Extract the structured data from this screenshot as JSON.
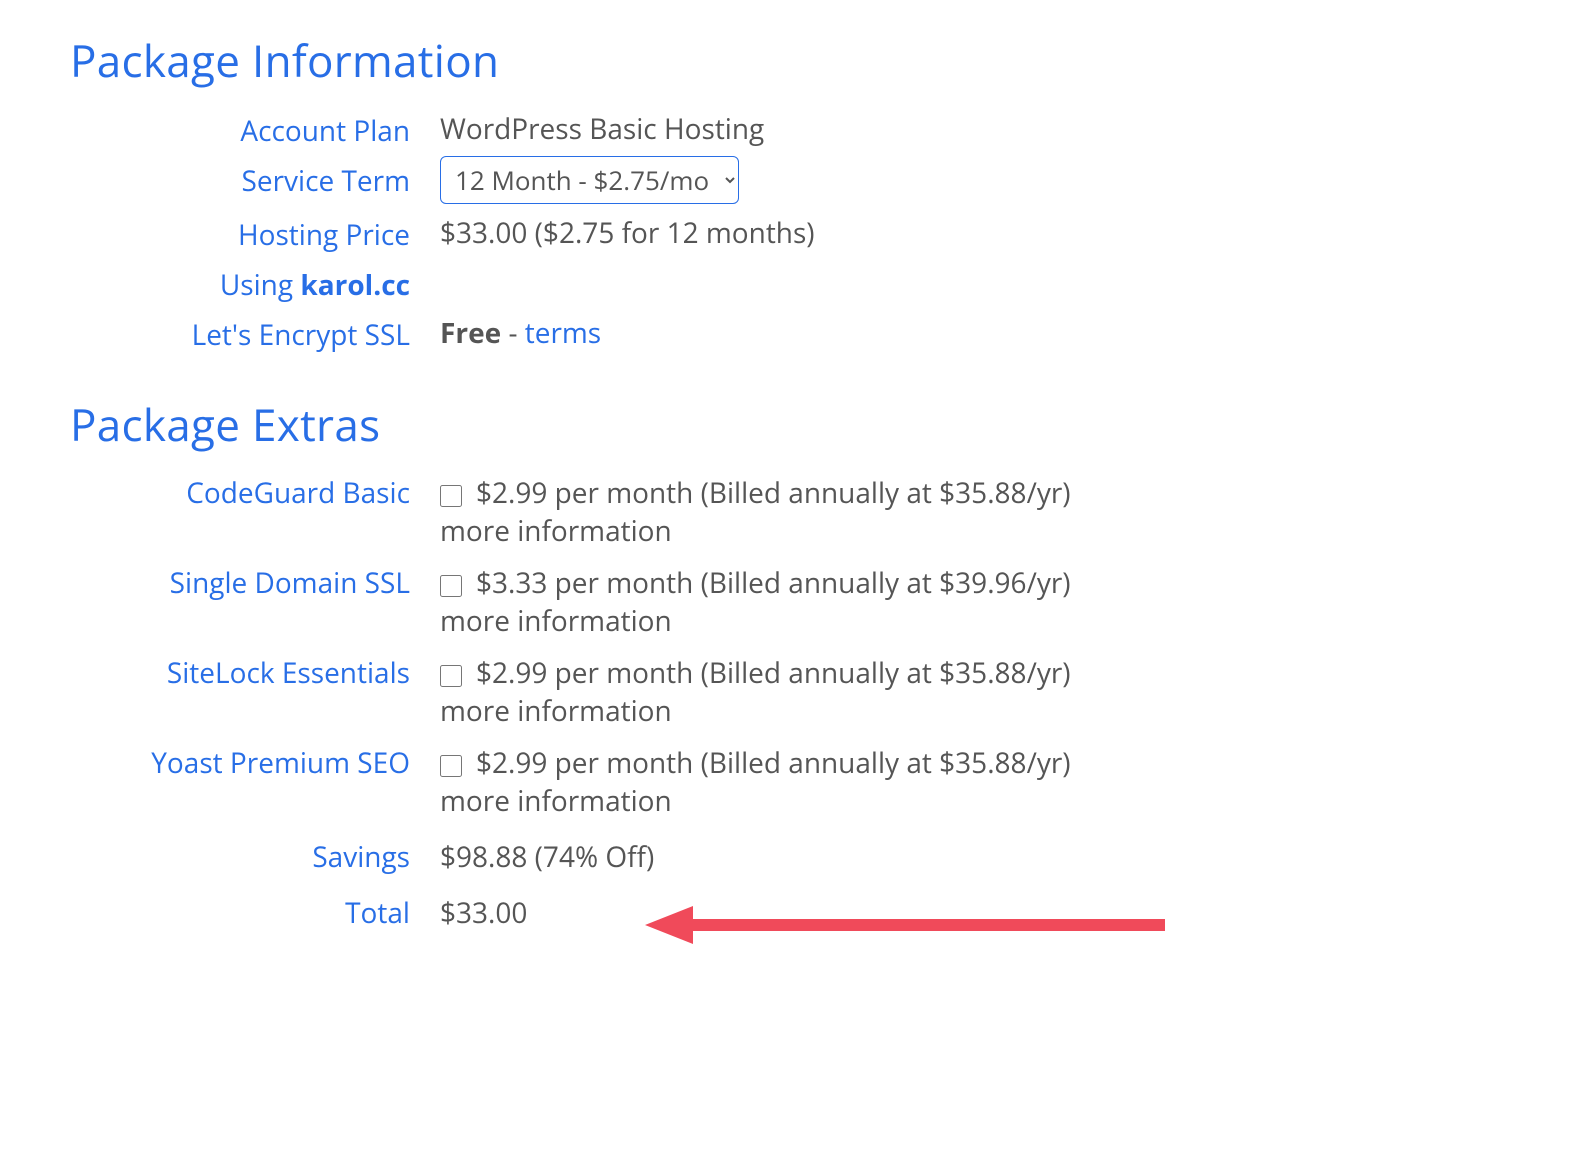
{
  "sections": {
    "info_heading": "Package Information",
    "extras_heading": "Package Extras"
  },
  "labels": {
    "account_plan": "Account Plan",
    "service_term": "Service Term",
    "hosting_price": "Hosting Price",
    "using_prefix": "Using ",
    "domain": "karol.cc",
    "ssl_label": "Let's Encrypt SSL",
    "savings": "Savings",
    "total": "Total"
  },
  "values": {
    "account_plan": "WordPress Basic Hosting",
    "service_term_selected": "12 Month - $2.75/mo",
    "hosting_price": "$33.00 ($2.75 for 12 months)",
    "ssl_free": "Free",
    "ssl_dash": " - ",
    "ssl_terms": "terms",
    "savings": "$98.88 (74% Off)",
    "total": "$33.00"
  },
  "extras": [
    {
      "name": "CodeGuard Basic",
      "price": "$2.99 per month (Billed annually at $35.88/yr)",
      "more": "more information"
    },
    {
      "name": "Single Domain SSL",
      "price": "$3.33 per month (Billed annually at $39.96/yr)",
      "more": "more information"
    },
    {
      "name": "SiteLock Essentials",
      "price": "$2.99 per month (Billed annually at $35.88/yr)",
      "more": "more information"
    },
    {
      "name": "Yoast Premium SEO",
      "price": "$2.99 per month (Billed annually at $35.88/yr)",
      "more": "more information"
    }
  ]
}
